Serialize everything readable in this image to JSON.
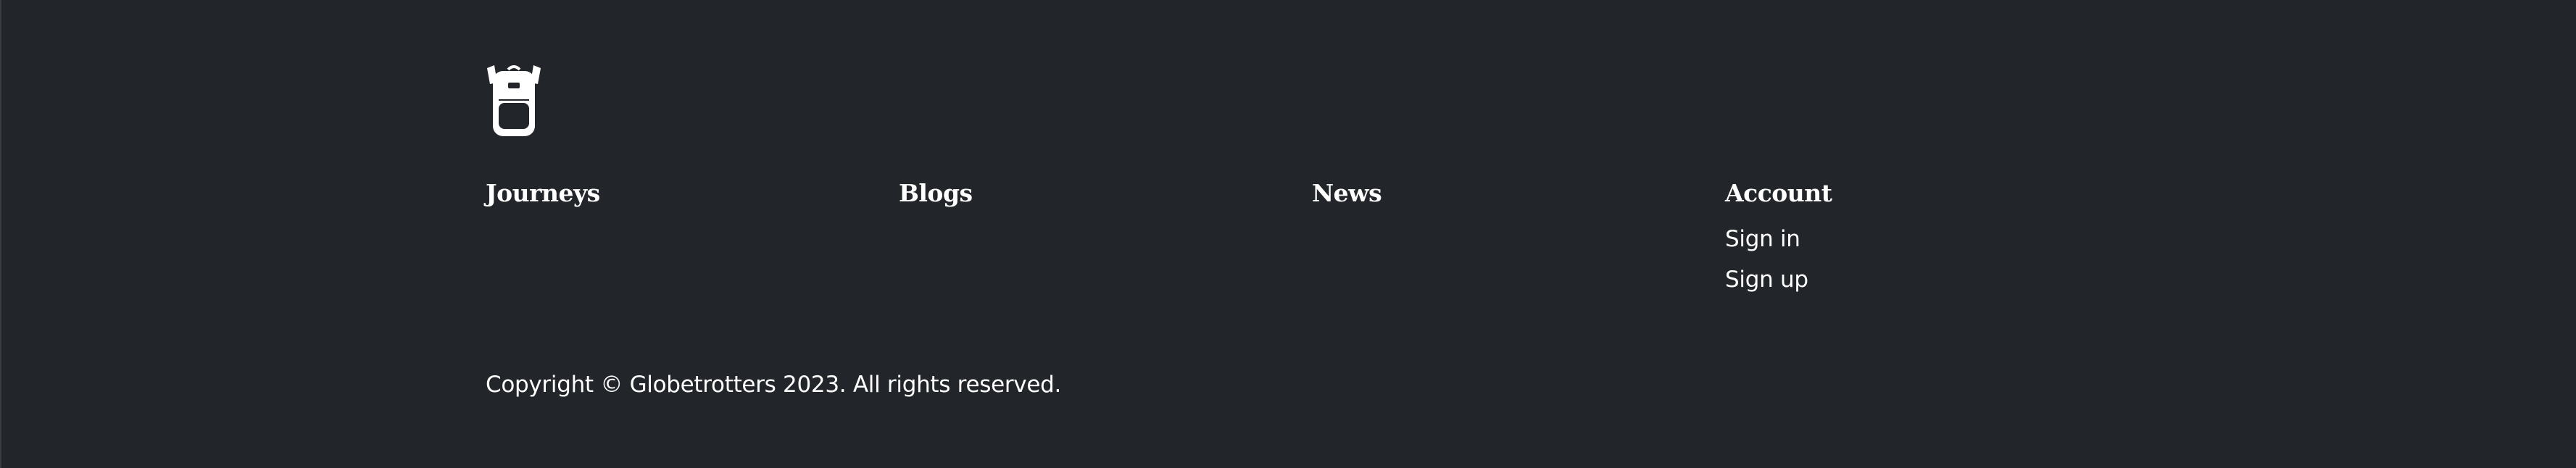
{
  "footer": {
    "logo_icon": "backpack-icon",
    "background_color": "#222529",
    "text_color": "#ffffff",
    "columns": [
      {
        "title": "Journeys",
        "links": []
      },
      {
        "title": "Blogs",
        "links": []
      },
      {
        "title": "News",
        "links": []
      },
      {
        "title": "Account",
        "links": [
          "Sign in",
          "Sign up"
        ]
      }
    ],
    "copyright": "Copyright © Globetrotters 2023. All rights reserved."
  }
}
